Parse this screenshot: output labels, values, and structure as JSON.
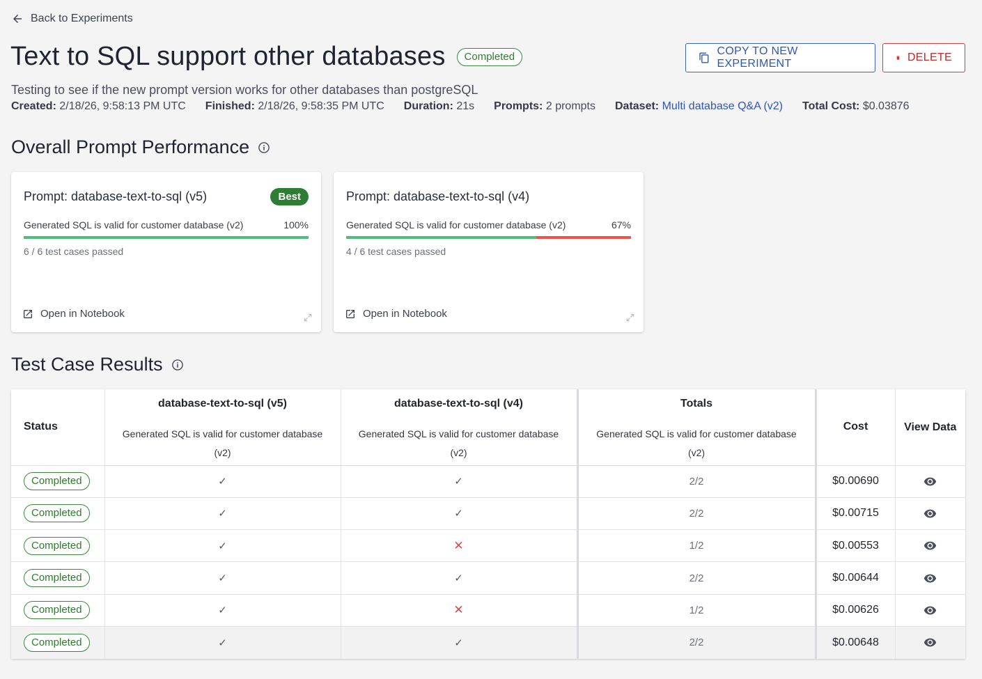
{
  "nav": {
    "back_label": "Back to Experiments"
  },
  "header": {
    "title": "Text to SQL support other databases",
    "status": "Completed",
    "copy_button": "COPY TO NEW EXPERIMENT",
    "delete_button": "DELETE",
    "description": "Testing to see if the new prompt version works for other databases than postgreSQL"
  },
  "meta": {
    "created_label": "Created:",
    "created_value": "2/18/26, 9:58:13 PM UTC",
    "finished_label": "Finished:",
    "finished_value": "2/18/26, 9:58:35 PM UTC",
    "duration_label": "Duration:",
    "duration_value": "21s",
    "prompts_label": "Prompts:",
    "prompts_value": "2 prompts",
    "dataset_label": "Dataset:",
    "dataset_value": "Multi database Q&A (v2)",
    "cost_label": "Total Cost:",
    "cost_value": "$0.03876"
  },
  "performance": {
    "section_title": "Overall Prompt Performance",
    "cards": [
      {
        "title": "Prompt: database-text-to-sql (v5)",
        "badge": "Best",
        "metric_label": "Generated SQL is valid for customer database (v2)",
        "metric_percent": "100%",
        "pass_fraction": 1.0,
        "passed_text": "6 / 6 test cases passed",
        "open_label": "Open in Notebook"
      },
      {
        "title": "Prompt: database-text-to-sql (v4)",
        "badge": "",
        "metric_label": "Generated SQL is valid for customer database (v2)",
        "metric_percent": "67%",
        "pass_fraction": 0.667,
        "passed_text": "4 / 6 test cases passed",
        "open_label": "Open in Notebook"
      }
    ]
  },
  "results": {
    "section_title": "Test Case Results",
    "columns": {
      "status": "Status",
      "prompt_a": "database-text-to-sql (v5)",
      "prompt_b": "database-text-to-sql (v4)",
      "totals": "Totals",
      "evaluator": "Generated SQL is valid for customer database (v2)",
      "cost": "Cost",
      "view": "View Data"
    },
    "rows": [
      {
        "status": "Completed",
        "a": "✓",
        "b": "✓",
        "total": "2/2",
        "cost": "$0.00690"
      },
      {
        "status": "Completed",
        "a": "✓",
        "b": "✓",
        "total": "2/2",
        "cost": "$0.00715"
      },
      {
        "status": "Completed",
        "a": "✓",
        "b": "✕",
        "total": "1/2",
        "cost": "$0.00553"
      },
      {
        "status": "Completed",
        "a": "✓",
        "b": "✓",
        "total": "2/2",
        "cost": "$0.00644"
      },
      {
        "status": "Completed",
        "a": "✓",
        "b": "✕",
        "total": "1/2",
        "cost": "$0.00626"
      },
      {
        "status": "Completed",
        "a": "✓",
        "b": "✓",
        "total": "2/2",
        "cost": "$0.00648"
      }
    ]
  },
  "colors": {
    "accent_blue": "#2f55bb",
    "success_green": "#2e7d32",
    "bar_green": "#4cbf7f",
    "bar_red": "#ef5350",
    "danger_red": "#c62828"
  },
  "icons": [
    "arrow-left-icon",
    "copy-icon",
    "trash-icon",
    "info-icon",
    "external-link-icon",
    "expand-icon",
    "check-icon",
    "cross-icon",
    "eye-icon"
  ]
}
